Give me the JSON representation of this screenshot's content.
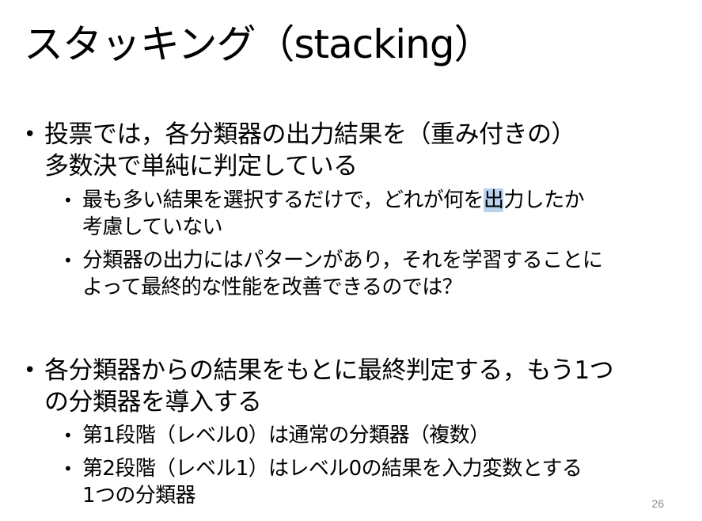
{
  "slide": {
    "title": "スタッキング（stacking）",
    "page_number": "26",
    "bullet_glyph": "•",
    "highlight_color": "#b9d3ee",
    "bullets": [
      {
        "text_line1": "投票では，各分類器の出力結果を（重み付きの）",
        "text_line2": "多数決で単純に判定している",
        "children": [
          {
            "text_before": "最も多い結果を選択するだけで，どれが何を",
            "text_highlight": "出",
            "text_after": "力したか",
            "text_line2": "考慮していない"
          },
          {
            "text_line1": "分類器の出力にはパターンがあり，それを学習することに",
            "text_line2": "よって最終的な性能を改善できるのでは？"
          }
        ]
      },
      {
        "text_line1": "各分類器からの結果をもとに最終判定する，もう1つ",
        "text_line2": "の分類器を導入する",
        "children": [
          {
            "text_line1": "第1段階（レベル0）は通常の分類器（複数）"
          },
          {
            "text_line1": "第2段階（レベル1）はレベル0の結果を入力変数とする",
            "text_line2": "1つの分類器"
          }
        ]
      }
    ]
  }
}
